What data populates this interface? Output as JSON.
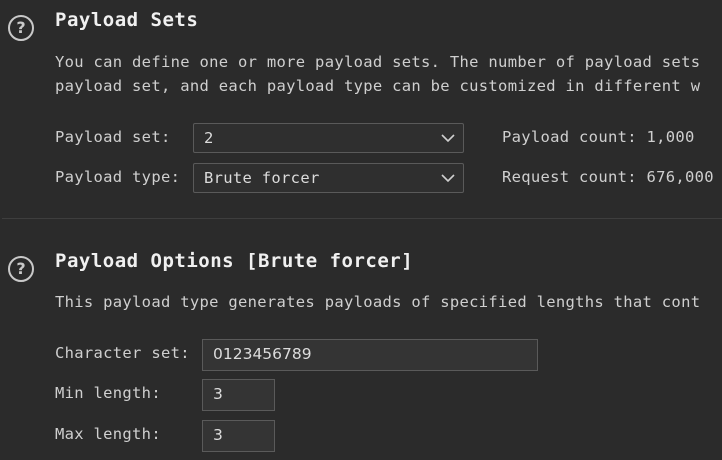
{
  "payload_sets": {
    "help_icon": "?",
    "title": "Payload Sets",
    "description_line1": "You can define one or more payload sets. The number of payload sets",
    "description_line2": "payload set, and each payload type can be customized in different w",
    "payload_set_label": "Payload set:",
    "payload_set_value": "2",
    "payload_type_label": "Payload type:",
    "payload_type_value": "Brute forcer",
    "payload_count": "Payload count: 1,000",
    "request_count": "Request count: 676,000"
  },
  "payload_options": {
    "help_icon": "?",
    "title": "Payload Options [Brute forcer]",
    "description": "This payload type generates payloads of specified lengths that cont",
    "character_set_label": "Character set:",
    "character_set_value": "0123456789",
    "min_length_label": "Min length:",
    "min_length_value": "3",
    "max_length_label": "Max length:",
    "max_length_value": "3"
  },
  "icons": {
    "help": "question-circle-icon",
    "dropdown": "chevron-down-icon"
  },
  "colors": {
    "background": "#2b2b2b",
    "title": "#f0f0f0",
    "text": "#cfcfcf",
    "field_border": "#5a5a5a"
  }
}
